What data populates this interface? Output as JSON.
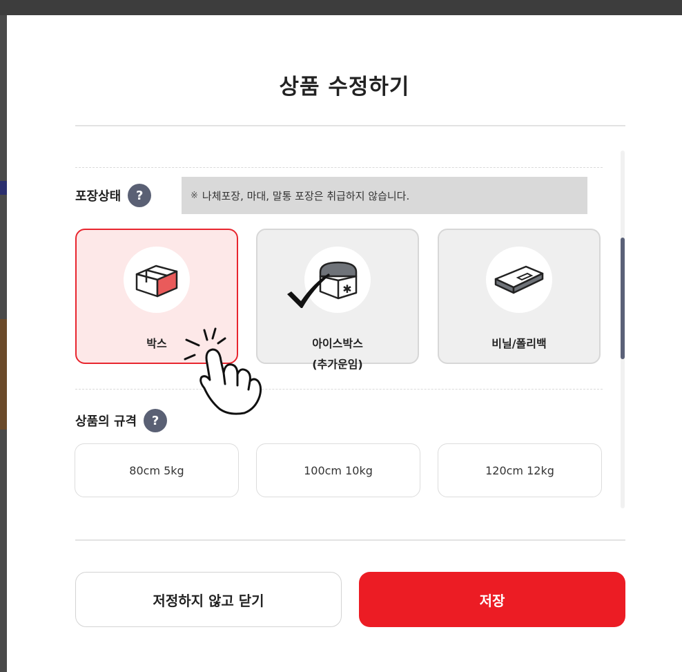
{
  "modal": {
    "title": "상품 수정하기"
  },
  "packaging": {
    "label": "포장상태",
    "help": "?",
    "notice_mark": "※",
    "notice": "나체포장, 마대, 말통 포장은 취급하지 않습니다.",
    "options": [
      {
        "label": "박스",
        "icon": "box-icon",
        "selected": true
      },
      {
        "label": "아이스박스",
        "label2": "(추가운임)",
        "icon": "icebox-icon",
        "selected": false
      },
      {
        "label": "비닐/폴리백",
        "icon": "polybag-icon",
        "selected": false
      }
    ]
  },
  "size": {
    "label": "상품의 규격",
    "help": "?",
    "options": [
      "80cm 5kg",
      "100cm 10kg",
      "120cm 12kg"
    ]
  },
  "actions": {
    "close_label": "저정하지 않고 닫기",
    "save_label": "저장"
  },
  "colors": {
    "accent": "#ec1c24",
    "selected_bg": "#fde8e8",
    "help_icon": "#5a6074",
    "notice_bg": "#d9d9d9"
  }
}
